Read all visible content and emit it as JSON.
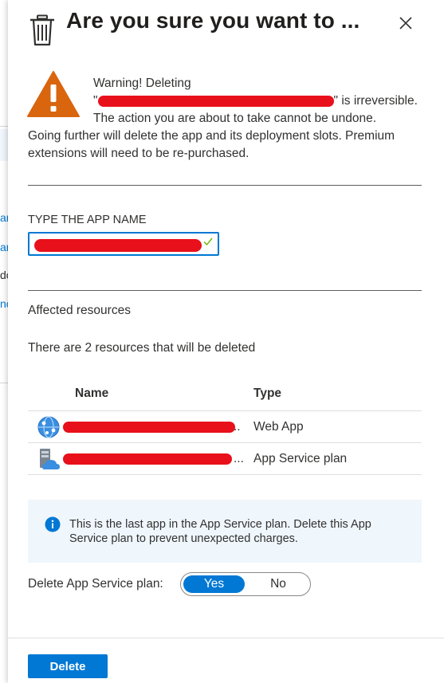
{
  "background": {
    "fragments": [
      "ar",
      "ar",
      "do",
      "nc"
    ]
  },
  "dialog": {
    "title": "Are you sure you want to ...",
    "close_label": "Close"
  },
  "warning": {
    "line1": "Warning! Deleting",
    "open_quote": "\"",
    "line2_suffix": "\" is irreversible.",
    "line3": "The action you are about to take cannot be undone.",
    "body": "Going further will delete the app and its deployment slots. Premium extensions will need to be re-purchased."
  },
  "app_name": {
    "label": "TYPE THE APP NAME",
    "validated": true
  },
  "affected": {
    "heading": "Affected resources",
    "summary": "There are 2 resources that will be deleted",
    "columns": [
      "Name",
      "Type"
    ],
    "rows": [
      {
        "icon": "web-app-icon",
        "name_suffix": "..",
        "type": "Web App"
      },
      {
        "icon": "app-service-plan-icon",
        "name_suffix": "...",
        "type": "App Service plan"
      }
    ]
  },
  "info": {
    "text": "This is the last app in the App Service plan. Delete this App Service plan to prevent unexpected charges."
  },
  "plan_toggle": {
    "label": "Delete App Service plan:",
    "yes": "Yes",
    "no": "No",
    "selected": "Yes"
  },
  "footer": {
    "delete_label": "Delete"
  },
  "colors": {
    "accent": "#0078d4",
    "warning": "#d9650f",
    "redaction": "#e8101b",
    "info_bg": "#eff6fc"
  }
}
